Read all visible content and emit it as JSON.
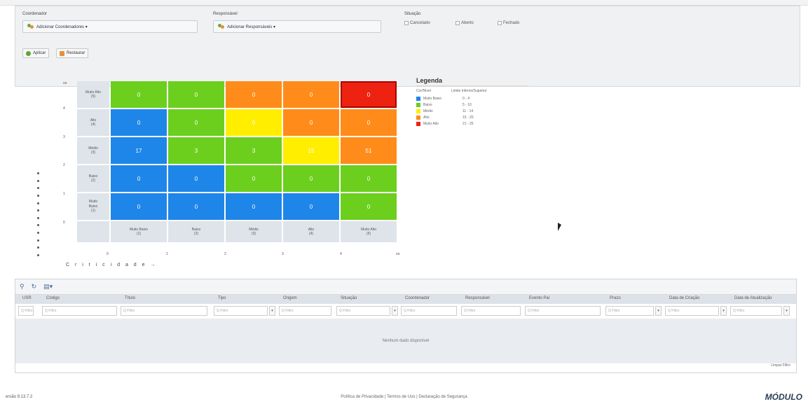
{
  "filters": {
    "coordenador_label": "Coordenador",
    "coordenador_value": "Adicionar Coordenadores ▾",
    "responsavel_label": "Responsável",
    "responsavel_value": "Adicionar Responsáveis ▾",
    "situacao_label": "Situação",
    "situacao_options": [
      "Cancelado",
      "Aberto",
      "Fechado"
    ],
    "apply_label": "Aplicar",
    "restore_label": "Restaurar"
  },
  "matrix": {
    "y_ticks": [
      "oo",
      "4",
      "3",
      "2",
      "1",
      "0"
    ],
    "x_ticks": [
      "0",
      "1",
      "2",
      "3",
      "4",
      "oo"
    ],
    "axis_label": "C r i t i c i d a d e →",
    "row_labels": [
      "Muito Alto\n(5)",
      "Alto\n(4)",
      "Médio\n(3)",
      "Baixo\n(2)",
      "Muito\nBaixo\n(1)"
    ],
    "col_labels": [
      "Muito Baixo\n(1)",
      "Baixo\n(2)",
      "Médio\n(3)",
      "Alto\n(4)",
      "Muito Alto\n(5)"
    ],
    "rows": [
      [
        {
          "v": "0",
          "c": "#6ccf1e"
        },
        {
          "v": "0",
          "c": "#6ccf1e"
        },
        {
          "v": "0",
          "c": "#ff8c1a"
        },
        {
          "v": "0",
          "c": "#ff8c1a"
        },
        {
          "v": "0",
          "c": "#ee2211"
        }
      ],
      [
        {
          "v": "0",
          "c": "#1e86e8"
        },
        {
          "v": "0",
          "c": "#6ccf1e"
        },
        {
          "v": "0",
          "c": "#ffee00"
        },
        {
          "v": "0",
          "c": "#ff8c1a"
        },
        {
          "v": "0",
          "c": "#ff8c1a"
        }
      ],
      [
        {
          "v": "17",
          "c": "#1e86e8"
        },
        {
          "v": "3",
          "c": "#6ccf1e"
        },
        {
          "v": "3",
          "c": "#6ccf1e"
        },
        {
          "v": "15",
          "c": "#ffee00"
        },
        {
          "v": "51",
          "c": "#ff8c1a"
        }
      ],
      [
        {
          "v": "0",
          "c": "#1e86e8"
        },
        {
          "v": "0",
          "c": "#1e86e8"
        },
        {
          "v": "0",
          "c": "#6ccf1e"
        },
        {
          "v": "0",
          "c": "#6ccf1e"
        },
        {
          "v": "0",
          "c": "#6ccf1e"
        }
      ],
      [
        {
          "v": "0",
          "c": "#1e86e8"
        },
        {
          "v": "0",
          "c": "#1e86e8"
        },
        {
          "v": "0",
          "c": "#1e86e8"
        },
        {
          "v": "0",
          "c": "#1e86e8"
        },
        {
          "v": "0",
          "c": "#6ccf1e"
        }
      ]
    ]
  },
  "legend": {
    "title": "Legenda",
    "col1": "Cor/Nível",
    "col2": "Limite Inferior/Superior",
    "items": [
      {
        "name": "Muito Baixo",
        "range": "0 - 4",
        "color": "#1e86e8"
      },
      {
        "name": "Baixo",
        "range": "5 - 10",
        "color": "#6ccf1e"
      },
      {
        "name": "Médio",
        "range": "11 - 14",
        "color": "#ffee00"
      },
      {
        "name": "Alto",
        "range": "15 - 20",
        "color": "#ff8c1a"
      },
      {
        "name": "Muito Alto",
        "range": "21 - 25",
        "color": "#ee2211"
      }
    ]
  },
  "grid": {
    "columns": [
      "USR",
      "Código",
      "Título",
      "Tipo",
      "Origem",
      "Situação",
      "Coordenador",
      "Responsável",
      "Evento Pai",
      "Prazo",
      "Data de Criação",
      "Data de Atualização"
    ],
    "filter_placeholder": "Q Filtro",
    "empty": "Nenhum dado disponível",
    "clear": "Limpar Filtro"
  },
  "footer": {
    "version": "ersão 9.13.7.2",
    "links": "Política de Privacidade | Termos de Uso | Declaração de Segurança",
    "brand": "MÓDULO"
  }
}
